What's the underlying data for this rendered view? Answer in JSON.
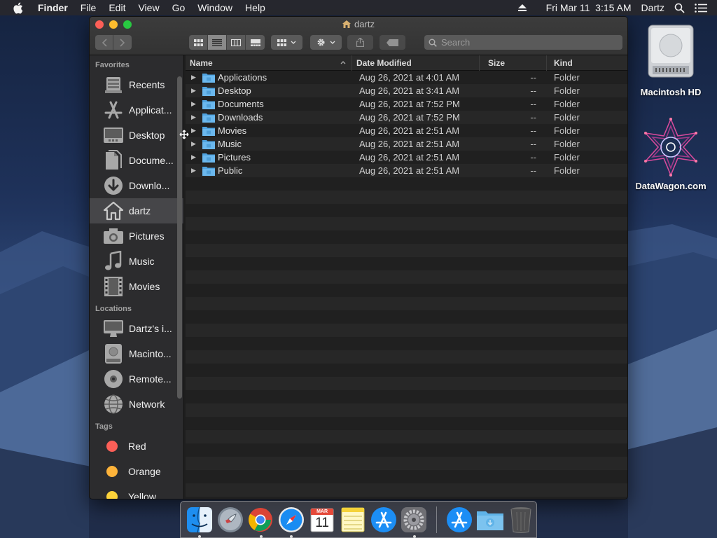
{
  "menubar": {
    "app_name": "Finder",
    "menus": [
      "File",
      "Edit",
      "View",
      "Go",
      "Window",
      "Help"
    ],
    "clock": "Fri Mar 11  3:15 AM",
    "user": "Dartz"
  },
  "window": {
    "title": "dartz",
    "search_placeholder": "Search"
  },
  "sidebar": {
    "favorites_header": "Favorites",
    "favorites": [
      {
        "label": "Recents",
        "icon": "recents-icon"
      },
      {
        "label": "Applicat...",
        "icon": "applications-icon"
      },
      {
        "label": "Desktop",
        "icon": "desktop-icon"
      },
      {
        "label": "Docume...",
        "icon": "documents-icon"
      },
      {
        "label": "Downlo...",
        "icon": "downloads-icon"
      },
      {
        "label": "dartz",
        "icon": "home-icon",
        "selected": true
      },
      {
        "label": "Pictures",
        "icon": "camera-icon"
      },
      {
        "label": "Music",
        "icon": "music-note-icon"
      },
      {
        "label": "Movies",
        "icon": "film-icon"
      }
    ],
    "locations_header": "Locations",
    "locations": [
      {
        "label": "Dartz's i...",
        "icon": "imac-icon"
      },
      {
        "label": "Macinto...",
        "icon": "hard-drive-icon"
      },
      {
        "label": "Remote...",
        "icon": "disc-icon"
      },
      {
        "label": "Network",
        "icon": "globe-icon"
      }
    ],
    "tags_header": "Tags",
    "tags": [
      {
        "label": "Red",
        "color": "#fc5f57"
      },
      {
        "label": "Orange",
        "color": "#fdb33a"
      },
      {
        "label": "Yellow",
        "color": "#fdd33a"
      }
    ]
  },
  "columns": {
    "name": "Name",
    "date": "Date Modified",
    "size": "Size",
    "kind": "Kind"
  },
  "files": [
    {
      "name": "Applications",
      "date": "Aug 26, 2021 at 4:01 AM",
      "size": "--",
      "kind": "Folder"
    },
    {
      "name": "Desktop",
      "date": "Aug 26, 2021 at 3:41 AM",
      "size": "--",
      "kind": "Folder"
    },
    {
      "name": "Documents",
      "date": "Aug 26, 2021 at 7:52 PM",
      "size": "--",
      "kind": "Folder"
    },
    {
      "name": "Downloads",
      "date": "Aug 26, 2021 at 7:52 PM",
      "size": "--",
      "kind": "Folder"
    },
    {
      "name": "Movies",
      "date": "Aug 26, 2021 at 2:51 AM",
      "size": "--",
      "kind": "Folder"
    },
    {
      "name": "Music",
      "date": "Aug 26, 2021 at 2:51 AM",
      "size": "--",
      "kind": "Folder"
    },
    {
      "name": "Pictures",
      "date": "Aug 26, 2021 at 2:51 AM",
      "size": "--",
      "kind": "Folder"
    },
    {
      "name": "Public",
      "date": "Aug 26, 2021 at 2:51 AM",
      "size": "--",
      "kind": "Folder"
    }
  ],
  "desktop_icons": [
    {
      "label": "Macintosh HD",
      "icon": "hard-drive-icon"
    },
    {
      "label": "DataWagon.com",
      "icon": "datawagon-logo-icon"
    }
  ],
  "dock": [
    {
      "name": "finder",
      "running": true
    },
    {
      "name": "launchpad",
      "running": false
    },
    {
      "name": "chrome",
      "running": true
    },
    {
      "name": "safari",
      "running": true
    },
    {
      "name": "calendar",
      "running": false,
      "month": "MAR",
      "day": "11"
    },
    {
      "name": "notes",
      "running": false
    },
    {
      "name": "app-store",
      "running": false
    },
    {
      "name": "system-preferences",
      "running": true
    },
    {
      "name": "app-store-downloads",
      "running": false
    },
    {
      "name": "downloads-folder",
      "running": false
    },
    {
      "name": "trash",
      "running": false
    }
  ]
}
